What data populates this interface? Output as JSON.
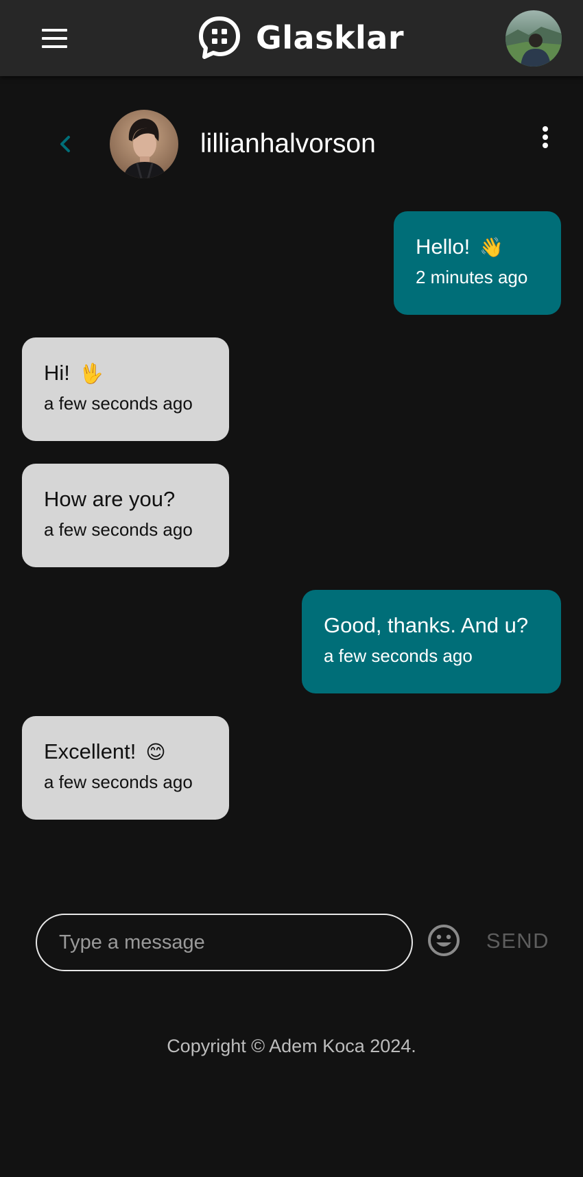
{
  "app": {
    "name": "Glasklar",
    "menu_icon": "hamburger-menu-icon",
    "logo_icon": "chat-bubble-logo-icon"
  },
  "chat": {
    "contact_name": "lillianhalvorson",
    "back_icon": "chevron-left-icon",
    "more_icon": "more-vertical-icon"
  },
  "messages": [
    {
      "text": "Hello!",
      "emoji": "👋",
      "time": "2 minutes ago",
      "direction": "sent"
    },
    {
      "text": "Hi!",
      "emoji": "🖖",
      "time": "a few seconds ago",
      "direction": "received"
    },
    {
      "text": "How are you?",
      "emoji": "",
      "time": "a few seconds ago",
      "direction": "received"
    },
    {
      "text": "Good, thanks. And u?",
      "emoji": "",
      "time": "a few seconds ago",
      "direction": "sent"
    },
    {
      "text": "Excellent!",
      "emoji": "😊",
      "time": "a few seconds ago",
      "direction": "received"
    }
  ],
  "composer": {
    "placeholder": "Type a message",
    "value": "",
    "emoji_icon": "smiley-face-icon",
    "send_label": "SEND"
  },
  "footer": {
    "copyright": "Copyright © Adem Koca 2024."
  },
  "colors": {
    "background": "#121212",
    "app_bar": "#272727",
    "sent_bubble": "#006e78",
    "received_bubble": "#d6d6d6",
    "accent": "#006e78"
  }
}
